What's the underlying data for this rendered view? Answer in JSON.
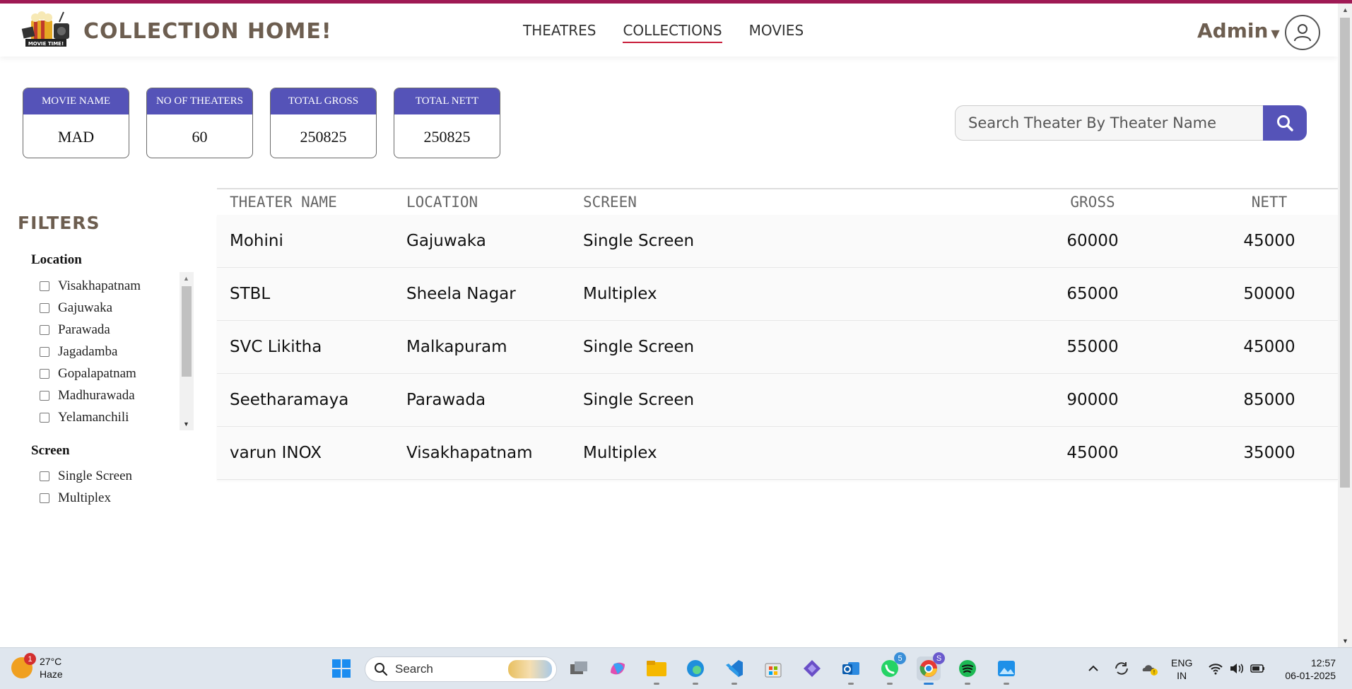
{
  "header": {
    "brand": "COLLECTION HOME!",
    "logo_text": "MOVIE TIME!",
    "nav": [
      "THEATRES",
      "COLLECTIONS",
      "MOVIES"
    ],
    "active_nav": "COLLECTIONS",
    "user_label": "Admin",
    "accent_color": "#a01a55",
    "nav_underline_color": "#c81d3a"
  },
  "stats": [
    {
      "label": "MOVIE NAME",
      "value": "MAD"
    },
    {
      "label": "NO OF THEATERS",
      "value": "60"
    },
    {
      "label": "TOTAL GROSS",
      "value": "250825"
    },
    {
      "label": "TOTAL NETT",
      "value": "250825"
    }
  ],
  "search": {
    "placeholder": "Search Theater By Theater Name",
    "value": "",
    "button_color": "#5553b8"
  },
  "filters": {
    "title": "FILTERS",
    "location": {
      "title": "Location",
      "options": [
        "Visakhapatnam",
        "Gajuwaka",
        "Parawada",
        "Jagadamba",
        "Gopalapatnam",
        "Madhurawada",
        "Yelamanchili"
      ]
    },
    "screen": {
      "title": "Screen",
      "options": [
        "Single Screen",
        "Multiplex"
      ]
    }
  },
  "table": {
    "columns": [
      "THEATER NAME",
      "LOCATION",
      "SCREEN",
      "GROSS",
      "NETT"
    ],
    "rows": [
      [
        "Mohini",
        "Gajuwaka",
        "Single Screen",
        "60000",
        "45000"
      ],
      [
        "STBL",
        "Sheela Nagar",
        "Multiplex",
        "65000",
        "50000"
      ],
      [
        "SVC Likitha",
        "Malkapuram",
        "Single Screen",
        "55000",
        "45000"
      ],
      [
        "Seetharamaya",
        "Parawada",
        "Single Screen",
        "90000",
        "85000"
      ],
      [
        "varun INOX",
        "Visakhapatnam",
        "Multiplex",
        "45000",
        "35000"
      ]
    ]
  },
  "taskbar": {
    "weather_temp": "27°C",
    "weather_desc": "Haze",
    "weather_badge": "1",
    "search_label": "Search",
    "whatsapp_badge": "5",
    "chrome_badge": "S",
    "lang_line1": "ENG",
    "lang_line2": "IN",
    "time": "12:57",
    "date": "06-01-2025"
  }
}
